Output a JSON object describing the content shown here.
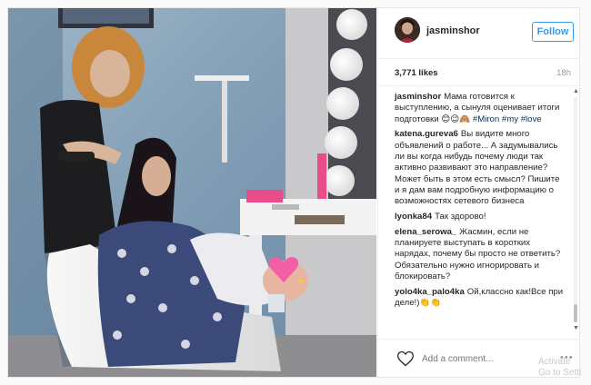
{
  "post": {
    "username": "jasminshor",
    "follow_label": "Follow",
    "likes": "3,771 likes",
    "time": "18h"
  },
  "comments": [
    {
      "user": "jasminshor",
      "parts": [
        {
          "text": "Мама готовится к выступлению, а сынуля оценивает итоги подготовки 😊😉🙈 ",
          "tag": false
        },
        {
          "text": "#Miron",
          "tag": true
        },
        {
          "text": " ",
          "tag": false
        },
        {
          "text": "#my",
          "tag": true
        },
        {
          "text": " ",
          "tag": false
        },
        {
          "text": "#love",
          "tag": true
        }
      ]
    },
    {
      "user": "katena.gureva6",
      "parts": [
        {
          "text": "Вы видите много объявлений о работе... А задумывались ли вы когда нибудь почему люди так активно развивают это направление? Может быть в этом есть смысл? Пишите и я дам вам подробную информацию о возможностях сетевого бизнеса",
          "tag": false
        }
      ]
    },
    {
      "user": "lyonka84",
      "parts": [
        {
          "text": "Так здорово!",
          "tag": false
        }
      ]
    },
    {
      "user": "elena_serowa_",
      "parts": [
        {
          "text": "Жасмин, если не планируете выступать в коротких нарядах, почему бы просто не ответить? Обязательно нужно игнорировать и блокировать?",
          "tag": false
        }
      ]
    },
    {
      "user": "yolo4ka_palo4ka",
      "parts": [
        {
          "text": "Ой,классно как!Все при деле!)👏👏",
          "tag": false
        }
      ]
    }
  ],
  "footer": {
    "comment_placeholder": "Add a comment...",
    "more": "•••"
  },
  "watermark": {
    "line1": "Activate",
    "line2": "Go to Setti"
  },
  "colors": {
    "accent": "#3897f0",
    "hashtag": "#003569",
    "border": "#efefef"
  },
  "icons": {
    "heart": "heart-icon",
    "scroll_up": "scroll-up-arrow-icon",
    "scroll_down": "scroll-down-arrow-icon"
  }
}
